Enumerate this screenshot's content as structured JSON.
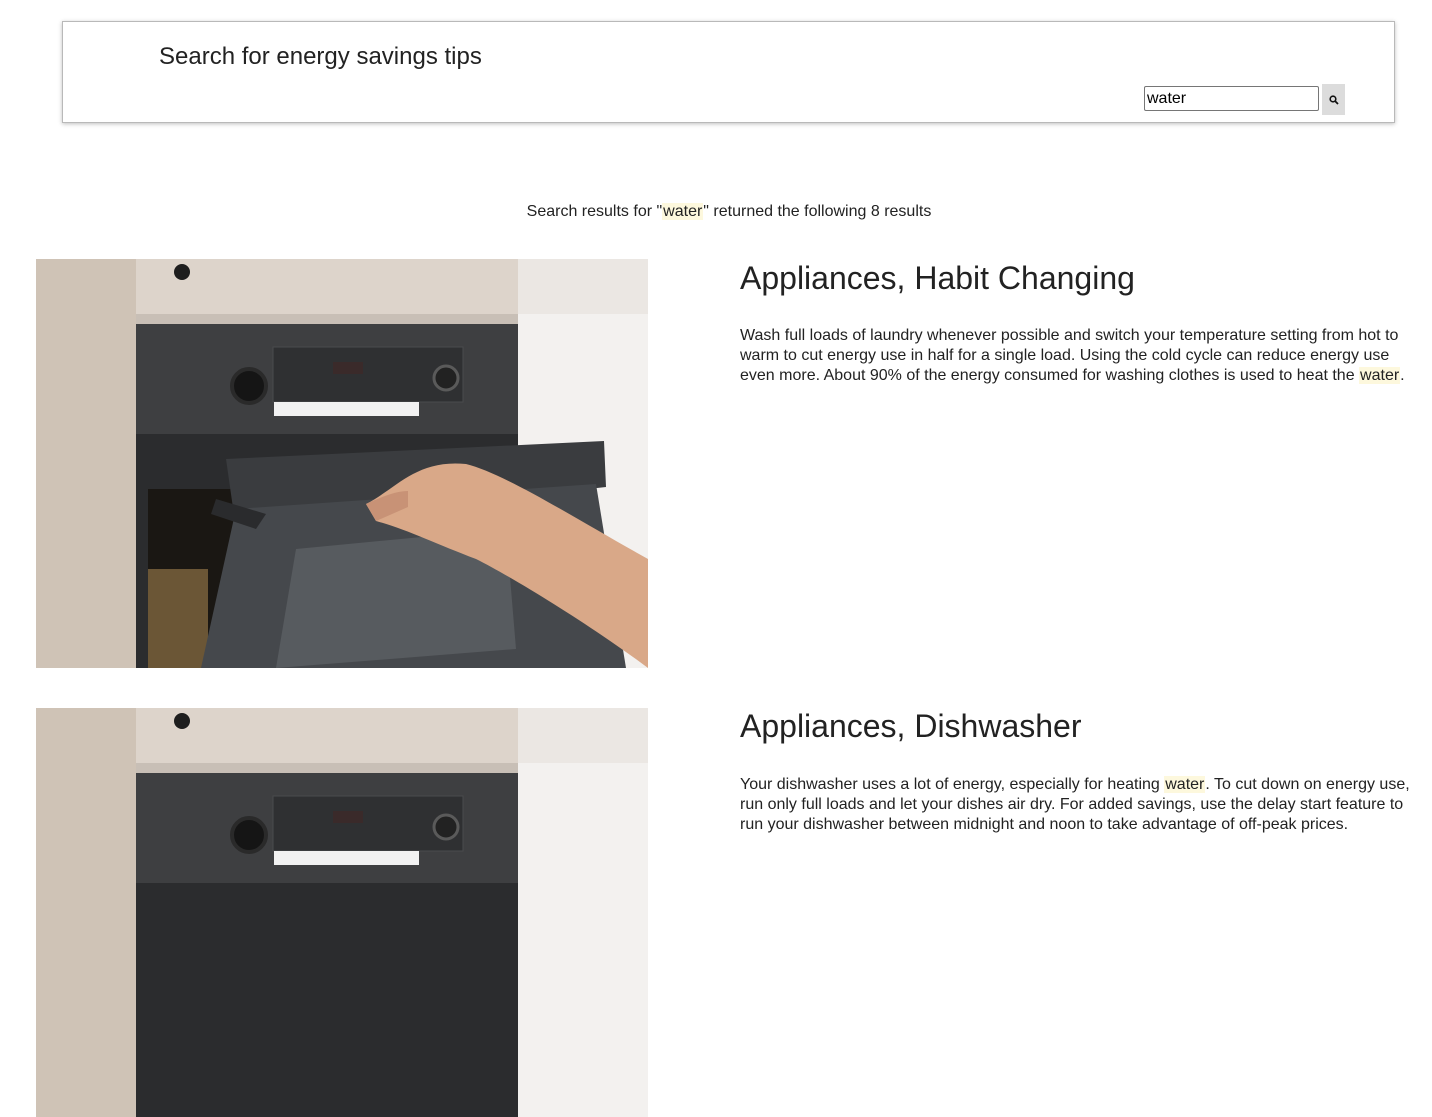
{
  "header": {
    "title": "Search for energy savings tips",
    "search_value": "water"
  },
  "summary": {
    "prefix": "Search results for \"",
    "term": "water",
    "suffix": "\" returned the following 8 results"
  },
  "results": [
    {
      "title": "Appliances, Habit Changing",
      "desc_before": "Wash full loads of laundry whenever possible and switch your temperature setting from hot to warm to cut energy use in half for a single load. Using the cold cycle can reduce energy use even more. About 90% of the energy consumed for washing clothes is used to heat the ",
      "desc_highlight": "water",
      "desc_after": ".",
      "image": "oven-image"
    },
    {
      "title": "Appliances, Dishwasher",
      "desc_before": "Your dishwasher uses a lot of energy, especially for heating ",
      "desc_highlight": "water",
      "desc_after": ". To cut down on energy use, run only full loads and let your dishes air dry. For added savings, use the delay start feature to run your dishwasher between midnight and noon to take advantage of off-peak prices.",
      "image": "oven-image"
    }
  ],
  "colors": {
    "highlight": "#fdf8dd",
    "button_bg": "#dcdcdc",
    "text": "#222222"
  },
  "icons": {
    "search_button": "search-icon"
  }
}
